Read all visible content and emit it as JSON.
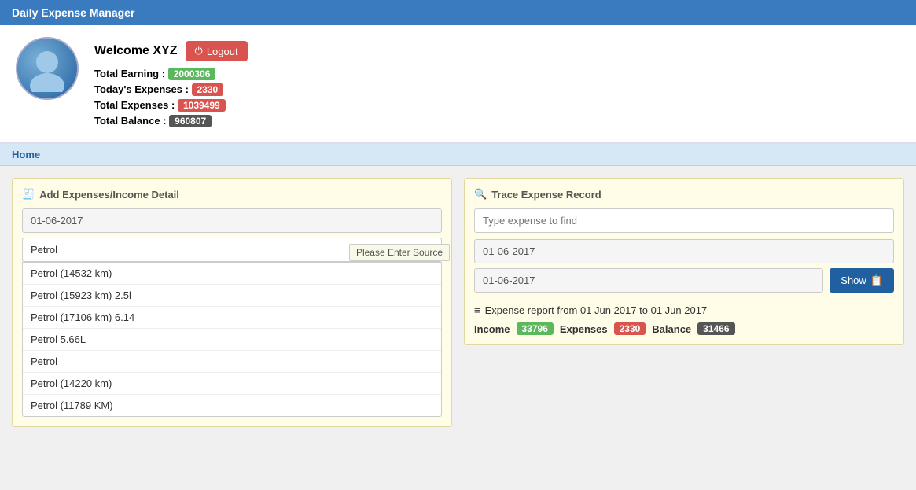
{
  "header": {
    "title": "Daily Expense Manager"
  },
  "profile": {
    "welcome": "Welcome XYZ",
    "logout_label": "Logout",
    "total_earning_label": "Total Earning :",
    "total_earning_value": "2000306",
    "todays_expenses_label": "Today's Expenses :",
    "todays_expenses_value": "2330",
    "total_expenses_label": "Total Expenses :",
    "total_expenses_value": "1039499",
    "total_balance_label": "Total Balance :",
    "total_balance_value": "960807"
  },
  "nav": {
    "home_label": "Home"
  },
  "add_expense": {
    "title": "Add Expenses/Income Detail",
    "date_value": "01-06-2017",
    "input_value": "Petrol",
    "tooltip": "Please Enter Source",
    "dropdown_items": [
      "Petrol (14532 km)",
      "Petrol (15923 km) 2.5l",
      "Petrol (17106 km) 6.14",
      "Petrol 5.66L",
      "Petrol",
      "Petrol (14220 km)",
      "Petrol (11789 KM)"
    ]
  },
  "trace": {
    "title": "Trace Expense Record",
    "search_placeholder": "Type expense to find",
    "date_from": "01-06-2017",
    "date_to": "01-06-2017",
    "show_label": "Show",
    "report_title": "Expense report from 01 Jun 2017 to 01 Jun 2017",
    "income_label": "Income",
    "income_value": "33796",
    "expenses_label": "Expenses",
    "expenses_value": "2330",
    "balance_label": "Balance",
    "balance_value": "31466"
  },
  "icons": {
    "logout": "⏻",
    "add": "🧾",
    "search": "🔍",
    "list": "≡",
    "leaf": "🌿",
    "show": "📋"
  }
}
